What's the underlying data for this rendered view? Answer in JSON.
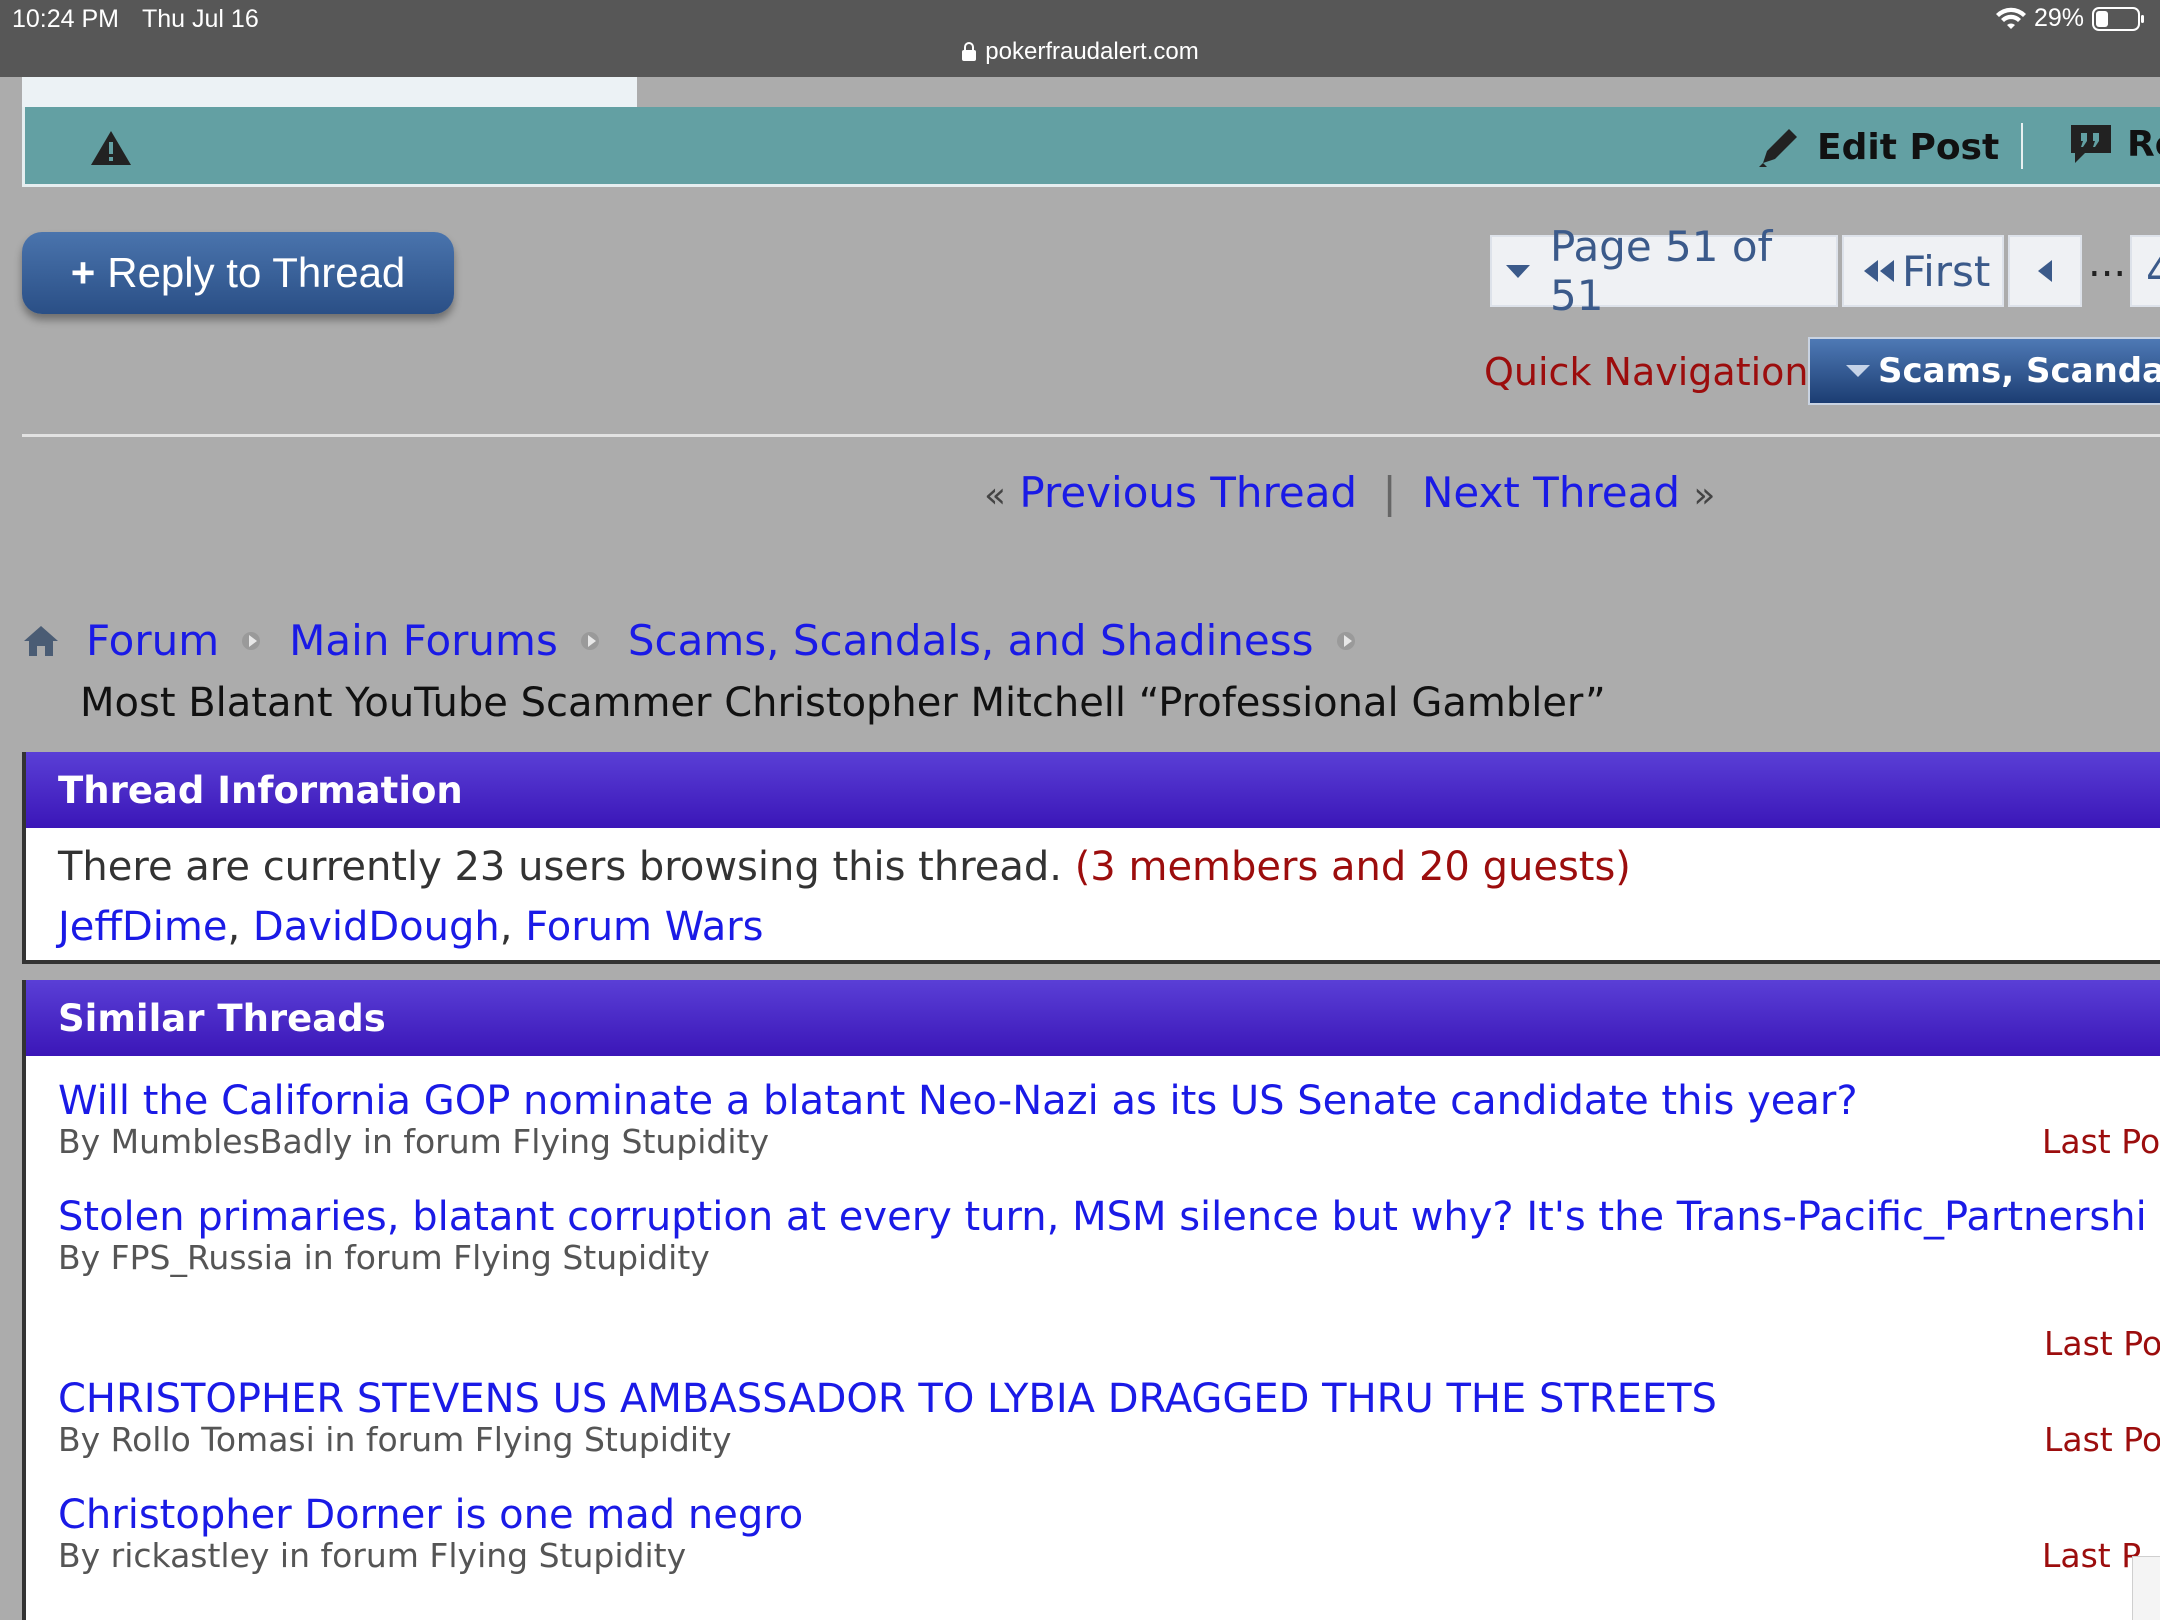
{
  "status_bar": {
    "time": "10:24 PM",
    "date": "Thu Jul 16",
    "battery": "29%",
    "url": "pokerfraudalert.com"
  },
  "post_toolbar": {
    "edit_post": "Edit Post",
    "reply_quote": "Re"
  },
  "reply_button": {
    "plus": "+",
    "label": "Reply to Thread"
  },
  "pagination": {
    "page_label": "Page 51 of 51",
    "first": "First",
    "ellipsis": "...",
    "page_number": "4"
  },
  "quick_nav": {
    "label": "Quick Navigation",
    "selected": "Scams, Scanda"
  },
  "thread_nav": {
    "prev_guillemet": "«",
    "previous": "Previous Thread",
    "separator": "|",
    "next": "Next Thread",
    "next_guillemet": "»"
  },
  "breadcrumb": {
    "items": [
      "Forum",
      "Main Forums",
      "Scams, Scandals, and Shadiness"
    ],
    "current": "Most Blatant YouTube Scammer Christopher Mitchell “Professional Gambler”"
  },
  "thread_info": {
    "heading": "Thread Information",
    "browsing_text": "There are currently 23 users browsing this thread.",
    "counts_text": "(3 members and 20 guests)",
    "members": [
      "JeffDime",
      "DavidDough",
      "Forum Wars"
    ],
    "separator": ","
  },
  "similar_threads": {
    "heading": "Similar Threads",
    "items": [
      {
        "title": "Will the California GOP nominate a blatant Neo-Nazi as its US Senate candidate this year?",
        "meta": "By MumblesBadly in forum Flying Stupidity",
        "last": "Last Po"
      },
      {
        "title": "Stolen primaries, blatant corruption at every turn, MSM silence but why? It's the Trans-Pacific_Partnershi",
        "meta": "By FPS_Russia in forum Flying Stupidity",
        "last": "Last Po"
      },
      {
        "title": "CHRISTOPHER STEVENS US AMBASSADOR TO LYBIA DRAGGED THRU THE STREETS",
        "meta": "By Rollo Tomasi in forum Flying Stupidity",
        "last": "Last Po"
      },
      {
        "title": "Christopher Dorner is one mad negro",
        "meta": "By rickastley in forum Flying Stupidity",
        "last": "Last P"
      }
    ]
  },
  "colors": {
    "link": "#1a1ae6",
    "maroon": "#9c0d0d",
    "teal": "#63a0a3",
    "header_purple": "#4a2bc8"
  }
}
